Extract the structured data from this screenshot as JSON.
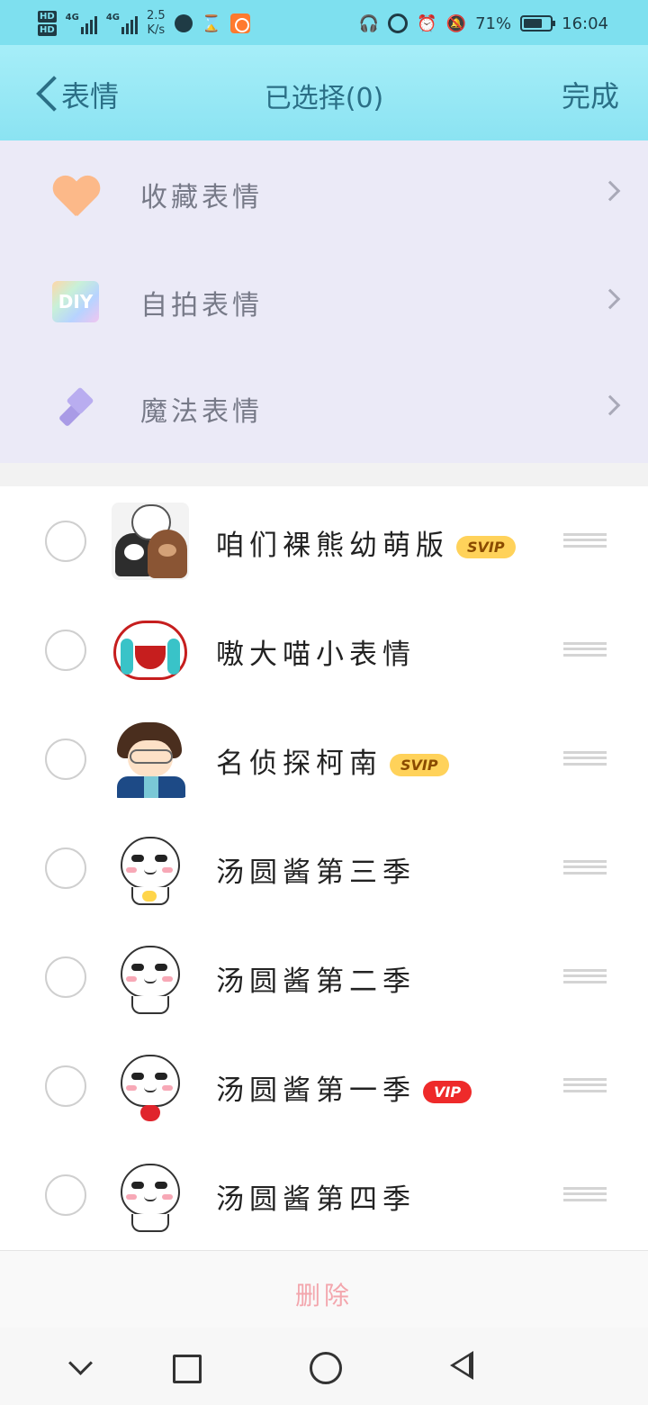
{
  "status_bar": {
    "hd1": "HD",
    "hd2": "HD",
    "sig1_label": "4G",
    "sig2_label": "4G",
    "speed_value": "2.5",
    "speed_unit": "K/s",
    "battery_pct": "71%",
    "battery_level": 0.71,
    "time": "16:04"
  },
  "header": {
    "back_label": "表情",
    "title": "已选择(0)",
    "done_label": "完成"
  },
  "categories": [
    {
      "label": "收藏表情",
      "icon": "heart-icon"
    },
    {
      "label": "自拍表情",
      "icon": "diy-icon",
      "icon_text": "DIY"
    },
    {
      "label": "魔法表情",
      "icon": "magic-wand-icon"
    }
  ],
  "packs": [
    {
      "name": "咱们裸熊幼萌版",
      "badge": "SVIP"
    },
    {
      "name": "嗷大喵小表情",
      "badge": ""
    },
    {
      "name": "名侦探柯南",
      "badge": "SVIP"
    },
    {
      "name": "汤圆酱第三季",
      "badge": ""
    },
    {
      "name": "汤圆酱第二季",
      "badge": ""
    },
    {
      "name": "汤圆酱第一季",
      "badge": "VIP"
    },
    {
      "name": "汤圆酱第四季",
      "badge": ""
    }
  ],
  "footer": {
    "delete_label": "删除"
  },
  "colors": {
    "header_bg": "#8be3f2",
    "accent_text": "#2b6f86",
    "delete_disabled": "#f3a6ad",
    "svip": "#ffd25a",
    "vip": "#ee2a2a"
  }
}
